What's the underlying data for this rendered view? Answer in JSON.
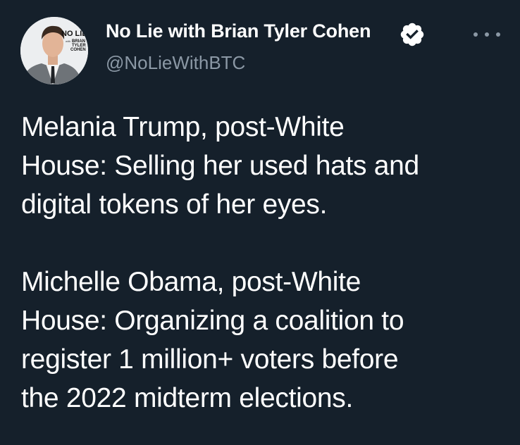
{
  "author": {
    "display_name": "No Lie with Brian Tyler Cohen",
    "handle": "@NoLieWithBTC",
    "avatar_logo_text": "NO LIE with BRIAN TYLER COHEN",
    "verified_icon": "verified-badge-icon"
  },
  "menu_icon": "more-options-icon",
  "tweet": {
    "paragraphs": [
      [
        "Melania Trump, post-White",
        "House: Selling her used hats and",
        "digital tokens of her eyes."
      ],
      [
        "Michelle Obama, post-White",
        "House: Organizing a coalition to",
        "register 1 million+ voters before",
        "the 2022 midterm elections."
      ]
    ]
  }
}
